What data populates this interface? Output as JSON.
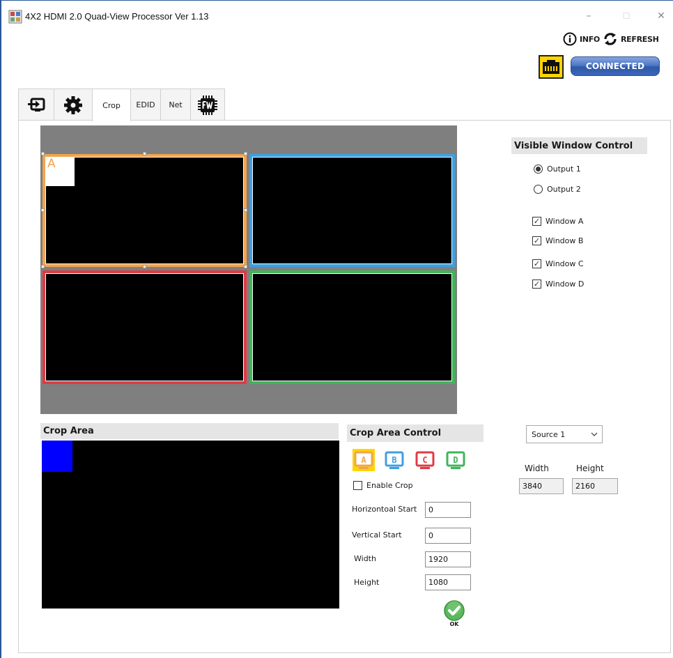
{
  "window": {
    "title": "4X2 HDMI 2.0 Quad-View Processor   Ver 1.13",
    "minimize": "–",
    "maximize": "☐",
    "close": "✕"
  },
  "header": {
    "info_label": "INFO",
    "refresh_label": "REFRESH",
    "connection_status": "CONNECTED"
  },
  "tabs": [
    {
      "label": "",
      "icon": "input-switch-icon"
    },
    {
      "label": "",
      "icon": "gear-icon"
    },
    {
      "label": "Crop",
      "active": true
    },
    {
      "label": "EDID"
    },
    {
      "label": "Net"
    },
    {
      "label": "",
      "icon": "fw-chip-icon"
    }
  ],
  "preview": {
    "window_a_label": "A",
    "colors": {
      "A": "#f0a450",
      "B": "#3ea0e0",
      "C": "#e03a44",
      "D": "#3fb55a"
    }
  },
  "visible_window_control": {
    "title": "Visible Window Control",
    "outputs": [
      {
        "label": "Output 1",
        "selected": true
      },
      {
        "label": "Output 2",
        "selected": false
      }
    ],
    "windows": [
      {
        "label": "Window A",
        "checked": true
      },
      {
        "label": "Window B",
        "checked": true
      },
      {
        "label": "Window C",
        "checked": true
      },
      {
        "label": "Window D",
        "checked": true
      }
    ]
  },
  "crop_area": {
    "title": "Crop Area"
  },
  "crop_area_control": {
    "title": "Crop Area Control",
    "sources": [
      "A",
      "B",
      "C",
      "D"
    ],
    "enable_crop_label": "Enable Crop",
    "enable_crop_checked": false,
    "horizontal_start_label": "Horizontoal Start",
    "horizontal_start_value": "0",
    "vertical_start_label": "Vertical Start",
    "vertical_start_value": "0",
    "width_label": "Width",
    "width_value": "1920",
    "height_label": "Height",
    "height_value": "1080",
    "ok_label": "OK"
  },
  "source_info": {
    "selected_source": "Source 1",
    "width_label": "Width",
    "height_label": "Height",
    "width_value": "3840",
    "height_value": "2160"
  }
}
